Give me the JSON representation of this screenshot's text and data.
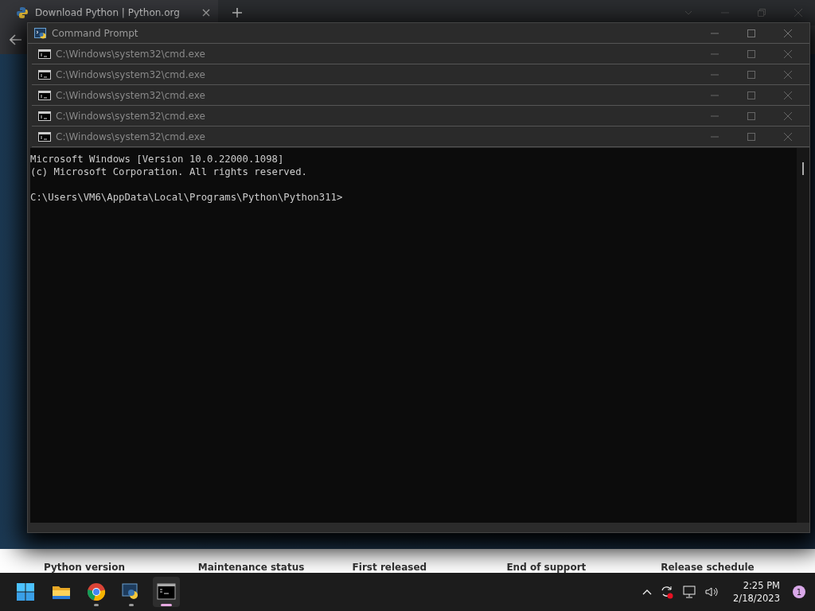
{
  "browser": {
    "tab": {
      "title": "Download Python | Python.org"
    },
    "table_headers": [
      "Python version",
      "Maintenance status",
      "First released",
      "End of support",
      "Release schedule"
    ]
  },
  "command_prompt": {
    "title": "Command Prompt",
    "child_windows": [
      {
        "title": "C:\\Windows\\system32\\cmd.exe"
      },
      {
        "title": "C:\\Windows\\system32\\cmd.exe"
      },
      {
        "title": "C:\\Windows\\system32\\cmd.exe"
      },
      {
        "title": "C:\\Windows\\system32\\cmd.exe"
      },
      {
        "title": "C:\\Windows\\system32\\cmd.exe"
      }
    ],
    "output": [
      "Microsoft Windows [Version 10.0.22000.1098]",
      "(c) Microsoft Corporation. All rights reserved."
    ],
    "prompt": "C:\\Users\\VM6\\AppData\\Local\\Programs\\Python\\Python311>"
  },
  "taskbar": {
    "apps": [
      {
        "kind": "explorer",
        "running": false,
        "selected": false
      },
      {
        "kind": "chrome",
        "running": true,
        "selected": false
      },
      {
        "kind": "python",
        "running": true,
        "selected": false
      },
      {
        "kind": "terminal",
        "running": true,
        "selected": true
      }
    ],
    "time": "2:25 PM",
    "date": "2/18/2023",
    "notification_count": "1"
  }
}
